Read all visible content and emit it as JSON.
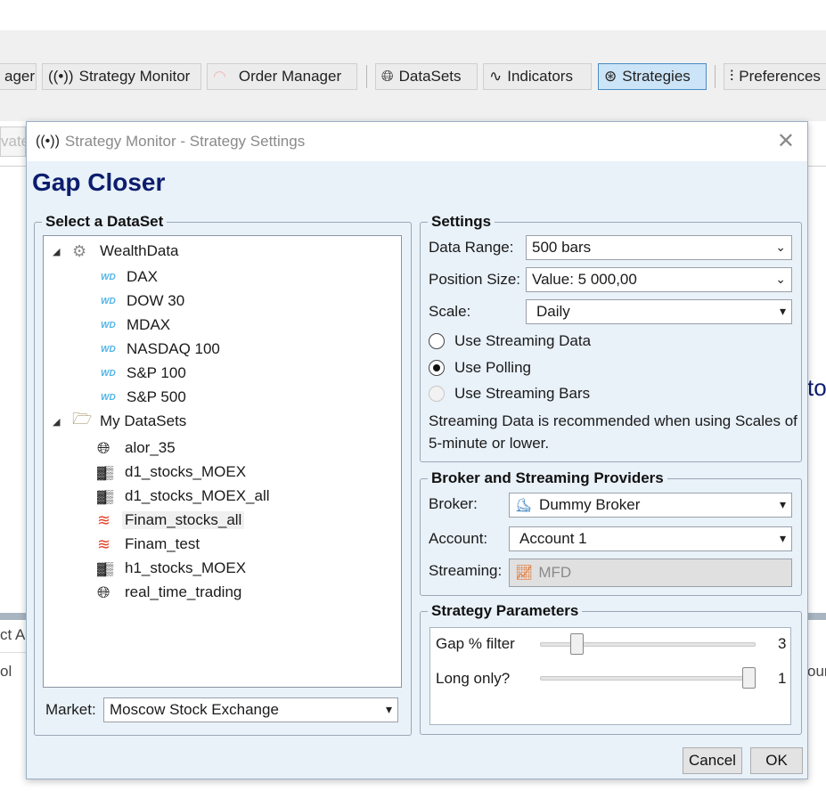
{
  "toolbar": {
    "items": [
      {
        "label": "ager",
        "icon": "monitor-icon"
      },
      {
        "label": "Strategy Monitor",
        "icon": "broadcast-icon"
      },
      {
        "label": "Order Manager",
        "icon": "wifi-icon"
      },
      {
        "label": "DataSets",
        "icon": "globe-icon"
      },
      {
        "label": "Indicators",
        "icon": "wave-icon"
      },
      {
        "label": "Strategies",
        "icon": "brain-icon",
        "active": true
      },
      {
        "label": "Preferences",
        "icon": "sliders-icon"
      }
    ]
  },
  "background": {
    "frag_vate": "vate",
    "frag_ct": "ct A",
    "frag_ol": "ol",
    "frag_to": "to",
    "frag_our": "our"
  },
  "dialog": {
    "title": "Strategy Monitor - Strategy Settings",
    "strategy_name": "Gap Closer",
    "dataset_group": {
      "legend": "Select a DataSet",
      "tree": [
        {
          "label": "WealthData",
          "icon": "gear-icon",
          "expanded": true
        },
        {
          "label": "DAX",
          "icon": "wd-icon"
        },
        {
          "label": "DOW 30",
          "icon": "wd-icon"
        },
        {
          "label": "MDAX",
          "icon": "wd-icon"
        },
        {
          "label": "NASDAQ 100",
          "icon": "wd-icon"
        },
        {
          "label": "S&P 100",
          "icon": "wd-icon"
        },
        {
          "label": "S&P 500",
          "icon": "wd-icon"
        },
        {
          "label": "My DataSets",
          "icon": "folder-open-icon",
          "expanded": true
        },
        {
          "label": "alor_35",
          "icon": "globe-icon"
        },
        {
          "label": "d1_stocks_MOEX",
          "icon": "noise-icon"
        },
        {
          "label": "d1_stocks_MOEX_all",
          "icon": "noise-icon"
        },
        {
          "label": "Finam_stocks_all",
          "icon": "finam-icon",
          "selected": true
        },
        {
          "label": "Finam_test",
          "icon": "finam-icon"
        },
        {
          "label": "h1_stocks_MOEX",
          "icon": "noise-icon"
        },
        {
          "label": "real_time_trading",
          "icon": "globe-icon"
        }
      ],
      "market_label": "Market:",
      "market_value": "Moscow Stock Exchange"
    },
    "settings_group": {
      "legend": "Settings",
      "data_range_label": "Data Range:",
      "data_range_value": "500 bars",
      "position_size_label": "Position Size:",
      "position_size_value": "Value: 5 000,00",
      "scale_label": "Scale:",
      "scale_value": "Daily",
      "radio_streaming": "Use Streaming Data",
      "radio_polling": "Use Polling",
      "radio_streaming_bars": "Use Streaming Bars",
      "selected_mode": "Use Polling",
      "note": "Streaming Data is recommended when using Scales of 5-minute or lower."
    },
    "broker_group": {
      "legend": "Broker and Streaming Providers",
      "broker_label": "Broker:",
      "broker_value": "Dummy Broker",
      "account_label": "Account:",
      "account_value": "Account 1",
      "streaming_label": "Streaming:",
      "streaming_value": "MFD"
    },
    "params_group": {
      "legend": "Strategy Parameters",
      "params": [
        {
          "label": "Gap % filter",
          "value": "3",
          "fraction": 0.15
        },
        {
          "label": "Long only?",
          "value": "1",
          "fraction": 1.0
        }
      ]
    },
    "buttons": {
      "cancel": "Cancel",
      "ok": "OK"
    }
  }
}
